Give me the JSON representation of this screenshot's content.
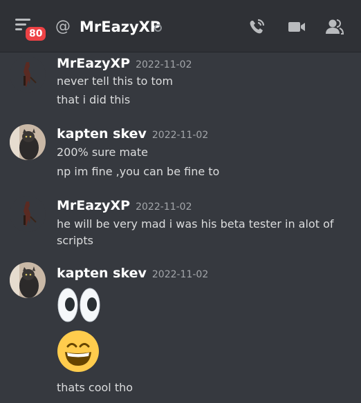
{
  "header": {
    "unread_badge": "80",
    "at_symbol": "@",
    "channel_name": "MrEazyXP",
    "icons": [
      "menu-icon",
      "at-icon",
      "call-icon",
      "video-icon",
      "members-icon"
    ]
  },
  "messages": [
    {
      "author": "MrEazyXP",
      "timestamp": "2022-11-02",
      "lines": [
        "never tell this to tom",
        "that i did this"
      ]
    },
    {
      "author": "kapten skev",
      "timestamp": "2022-11-02",
      "lines": [
        "200% sure mate",
        "np im fine ,you can be fine to"
      ]
    },
    {
      "author": "MrEazyXP",
      "timestamp": "2022-11-02",
      "lines": [
        "he will be very mad i was his beta tester in alot of",
        "scripts"
      ]
    },
    {
      "author": "kapten skev",
      "timestamp": "2022-11-02",
      "emojis": [
        "eyes-emoji",
        "grinning-emoji"
      ],
      "lines": [
        "thats cool tho"
      ]
    }
  ],
  "colors": {
    "background": "#36393f",
    "header": "#2f3136",
    "badge": "#ed4245"
  }
}
